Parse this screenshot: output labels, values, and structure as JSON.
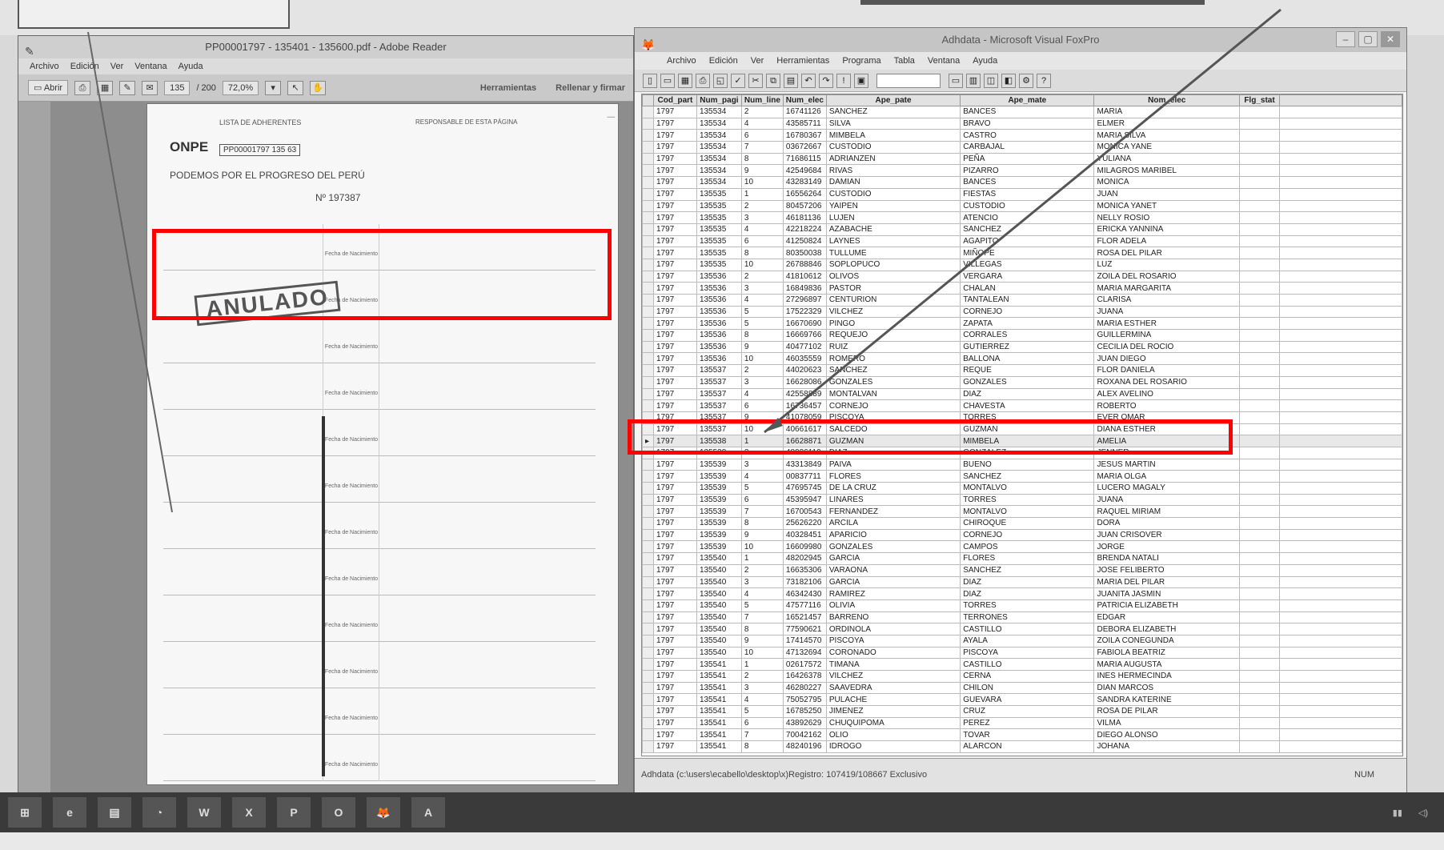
{
  "reader": {
    "title": "PP00001797 - 135401 - 135600.pdf - Adobe Reader",
    "menu": [
      "Archivo",
      "Edición",
      "Ver",
      "Ventana",
      "Ayuda"
    ],
    "toolbar": {
      "open": "Abrir",
      "page": "135",
      "of": "/ 200",
      "zoom": "72,0%",
      "tools": "Herramientas",
      "fill_sign": "Rellenar y firmar"
    },
    "pdf": {
      "list_title": "LISTA DE ADHERENTES",
      "responsible": "RESPONSABLE DE ESTA PÁGINA",
      "logo": "ONPE",
      "code": "PP00001797 135 63",
      "party": "PODEMOS POR EL PROGRESO DEL PERÚ",
      "number": "Nº 197387",
      "stamp": "ANULADO",
      "fecha_label": "Fecha de Nacimiento"
    }
  },
  "foxpro": {
    "title": "Adhdata - Microsoft Visual FoxPro",
    "menu": [
      "Archivo",
      "Edición",
      "Ver",
      "Herramientas",
      "Programa",
      "Tabla",
      "Ventana",
      "Ayuda"
    ],
    "columns": [
      "Cod_part",
      "Num_pagi",
      "Num_line",
      "Num_elec",
      "Ape_pate",
      "Ape_mate",
      "Nom_elec",
      "Flg_stat"
    ],
    "rows": [
      [
        "1797",
        "135534",
        "2",
        "16741126",
        "SANCHEZ",
        "BANCES",
        "MARIA",
        ""
      ],
      [
        "1797",
        "135534",
        "4",
        "43585711",
        "SILVA",
        "BRAVO",
        "ELMER",
        ""
      ],
      [
        "1797",
        "135534",
        "6",
        "16780367",
        "MIMBELA",
        "CASTRO",
        "MARIA SILVA",
        ""
      ],
      [
        "1797",
        "135534",
        "7",
        "03672667",
        "CUSTODIO",
        "CARBAJAL",
        "MONICA YANE",
        ""
      ],
      [
        "1797",
        "135534",
        "8",
        "71686115",
        "ADRIANZEN",
        "PEÑA",
        "YULIANA",
        ""
      ],
      [
        "1797",
        "135534",
        "9",
        "42549684",
        "RIVAS",
        "PIZARRO",
        "MILAGROS MARIBEL",
        ""
      ],
      [
        "1797",
        "135534",
        "10",
        "43283149",
        "DAMIAN",
        "BANCES",
        "MONICA",
        ""
      ],
      [
        "1797",
        "135535",
        "1",
        "16556264",
        "CUSTODIO",
        "FIESTAS",
        "JUAN",
        ""
      ],
      [
        "1797",
        "135535",
        "2",
        "80457206",
        "YAIPEN",
        "CUSTODIO",
        "MONICA YANET",
        ""
      ],
      [
        "1797",
        "135535",
        "3",
        "46181136",
        "LUJEN",
        "ATENCIO",
        "NELLY ROSIO",
        ""
      ],
      [
        "1797",
        "135535",
        "4",
        "42218224",
        "AZABACHE",
        "SANCHEZ",
        "ERICKA YANNINA",
        ""
      ],
      [
        "1797",
        "135535",
        "6",
        "41250824",
        "LAYNES",
        "AGAPITO",
        "FLOR ADELA",
        ""
      ],
      [
        "1797",
        "135535",
        "8",
        "80350038",
        "TULLUME",
        "MIÑOPE",
        "ROSA DEL PILAR",
        ""
      ],
      [
        "1797",
        "135535",
        "10",
        "26788846",
        "SOPLOPUCO",
        "VILLEGAS",
        "LUZ",
        ""
      ],
      [
        "1797",
        "135536",
        "2",
        "41810612",
        "OLIVOS",
        "VERGARA",
        "ZOILA DEL ROSARIO",
        ""
      ],
      [
        "1797",
        "135536",
        "3",
        "16849836",
        "PASTOR",
        "CHALAN",
        "MARIA MARGARITA",
        ""
      ],
      [
        "1797",
        "135536",
        "4",
        "27296897",
        "CENTURION",
        "TANTALEAN",
        "CLARISA",
        ""
      ],
      [
        "1797",
        "135536",
        "5",
        "17522329",
        "VILCHEZ",
        "CORNEJO",
        "JUANA",
        ""
      ],
      [
        "1797",
        "135536",
        "5",
        "16670690",
        "PINGO",
        "ZAPATA",
        "MARIA ESTHER",
        ""
      ],
      [
        "1797",
        "135536",
        "8",
        "16669766",
        "REQUEJO",
        "CORRALES",
        "GUILLERMINA",
        ""
      ],
      [
        "1797",
        "135536",
        "9",
        "40477102",
        "RUIZ",
        "GUTIERREZ",
        "CECILIA DEL ROCIO",
        ""
      ],
      [
        "1797",
        "135536",
        "10",
        "46035559",
        "ROMERO",
        "BALLONA",
        "JUAN DIEGO",
        ""
      ],
      [
        "1797",
        "135537",
        "2",
        "44020623",
        "SANCHEZ",
        "REQUE",
        "FLOR DANIELA",
        ""
      ],
      [
        "1797",
        "135537",
        "3",
        "16628086",
        "GONZALES",
        "GONZALES",
        "ROXANA DEL ROSARIO",
        ""
      ],
      [
        "1797",
        "135537",
        "4",
        "42558889",
        "MONTALVAN",
        "DIAZ",
        "ALEX AVELINO",
        ""
      ],
      [
        "1797",
        "135537",
        "6",
        "16736457",
        "CORNEJO",
        "CHAVESTA",
        "ROBERTO",
        ""
      ],
      [
        "1797",
        "135537",
        "9",
        "41078059",
        "PISCOYA",
        "TORRES",
        "EVER OMAR",
        ""
      ],
      [
        "1797",
        "135537",
        "10",
        "40661617",
        "SALCEDO",
        "GUZMAN",
        "DIANA ESTHER",
        ""
      ],
      [
        "1797",
        "135538",
        "1",
        "16628871",
        "GUZMAN",
        "MIMBELA",
        "AMELIA",
        ""
      ],
      [
        "1797",
        "135538",
        "2",
        "48026110",
        "DIAZ",
        "GONZALEZ",
        "JENNER",
        ""
      ],
      [
        "1797",
        "135539",
        "3",
        "43313849",
        "PAIVA",
        "BUENO",
        "JESUS MARTIN",
        ""
      ],
      [
        "1797",
        "135539",
        "4",
        "00837711",
        "FLORES",
        "SANCHEZ",
        "MARIA OLGA",
        ""
      ],
      [
        "1797",
        "135539",
        "5",
        "47695745",
        "DE LA CRUZ",
        "MONTALVO",
        "LUCERO MAGALY",
        ""
      ],
      [
        "1797",
        "135539",
        "6",
        "45395947",
        "LINARES",
        "TORRES",
        "JUANA",
        ""
      ],
      [
        "1797",
        "135539",
        "7",
        "16700543",
        "FERNANDEZ",
        "MONTALVO",
        "RAQUEL MIRIAM",
        ""
      ],
      [
        "1797",
        "135539",
        "8",
        "25626220",
        "ARCILA",
        "CHIROQUE",
        "DORA",
        ""
      ],
      [
        "1797",
        "135539",
        "9",
        "40328451",
        "APARICIO",
        "CORNEJO",
        "JUAN CRISOVER",
        ""
      ],
      [
        "1797",
        "135539",
        "10",
        "16609980",
        "GONZALES",
        "CAMPOS",
        "JORGE",
        ""
      ],
      [
        "1797",
        "135540",
        "1",
        "48202945",
        "GARCIA",
        "FLORES",
        "BRENDA NATALI",
        ""
      ],
      [
        "1797",
        "135540",
        "2",
        "16635306",
        "VARAONA",
        "SANCHEZ",
        "JOSE FELIBERTO",
        ""
      ],
      [
        "1797",
        "135540",
        "3",
        "73182106",
        "GARCIA",
        "DIAZ",
        "MARIA DEL PILAR",
        ""
      ],
      [
        "1797",
        "135540",
        "4",
        "46342430",
        "RAMIREZ",
        "DIAZ",
        "JUANITA JASMIN",
        ""
      ],
      [
        "1797",
        "135540",
        "5",
        "47577116",
        "OLIVIA",
        "TORRES",
        "PATRICIA ELIZABETH",
        ""
      ],
      [
        "1797",
        "135540",
        "7",
        "16521457",
        "BARRENO",
        "TERRONES",
        "EDGAR",
        ""
      ],
      [
        "1797",
        "135540",
        "8",
        "77590621",
        "ORDINOLA",
        "CASTILLO",
        "DEBORA ELIZABETH",
        ""
      ],
      [
        "1797",
        "135540",
        "9",
        "17414570",
        "PISCOYA",
        "AYALA",
        "ZOILA CONEGUNDA",
        ""
      ],
      [
        "1797",
        "135540",
        "10",
        "47132694",
        "CORONADO",
        "PISCOYA",
        "FABIOLA BEATRIZ",
        ""
      ],
      [
        "1797",
        "135541",
        "1",
        "02617572",
        "TIMANA",
        "CASTILLO",
        "MARIA AUGUSTA",
        ""
      ],
      [
        "1797",
        "135541",
        "2",
        "16426378",
        "VILCHEZ",
        "CERNA",
        "INES HERMECINDA",
        ""
      ],
      [
        "1797",
        "135541",
        "3",
        "46280227",
        "SAAVEDRA",
        "CHILON",
        "DIAN MARCOS",
        ""
      ],
      [
        "1797",
        "135541",
        "4",
        "75052795",
        "PULACHE",
        "GUEVARA",
        "SANDRA KATERINE",
        ""
      ],
      [
        "1797",
        "135541",
        "5",
        "16785250",
        "JIMENEZ",
        "CRUZ",
        "ROSA DE PILAR",
        ""
      ],
      [
        "1797",
        "135541",
        "6",
        "43892629",
        "CHUQUIPOMA",
        "PEREZ",
        "VILMA",
        ""
      ],
      [
        "1797",
        "135541",
        "7",
        "70042162",
        "OLIO",
        "TOVAR",
        "DIEGO ALONSO",
        ""
      ],
      [
        "1797",
        "135541",
        "8",
        "48240196",
        "IDROGO",
        "ALARCON",
        "JOHANA",
        ""
      ]
    ],
    "current_row": 28,
    "status": "Adhdata (c:\\users\\ecabello\\desktop\\x)Registro: 107419/108667 Exclusivo",
    "status_right": "NUM"
  },
  "taskbar": [
    "⊞",
    "e",
    "▤",
    "◔",
    "W",
    "X",
    "P",
    "O",
    "🦊",
    "A"
  ],
  "annotation_color": "#ff0000"
}
